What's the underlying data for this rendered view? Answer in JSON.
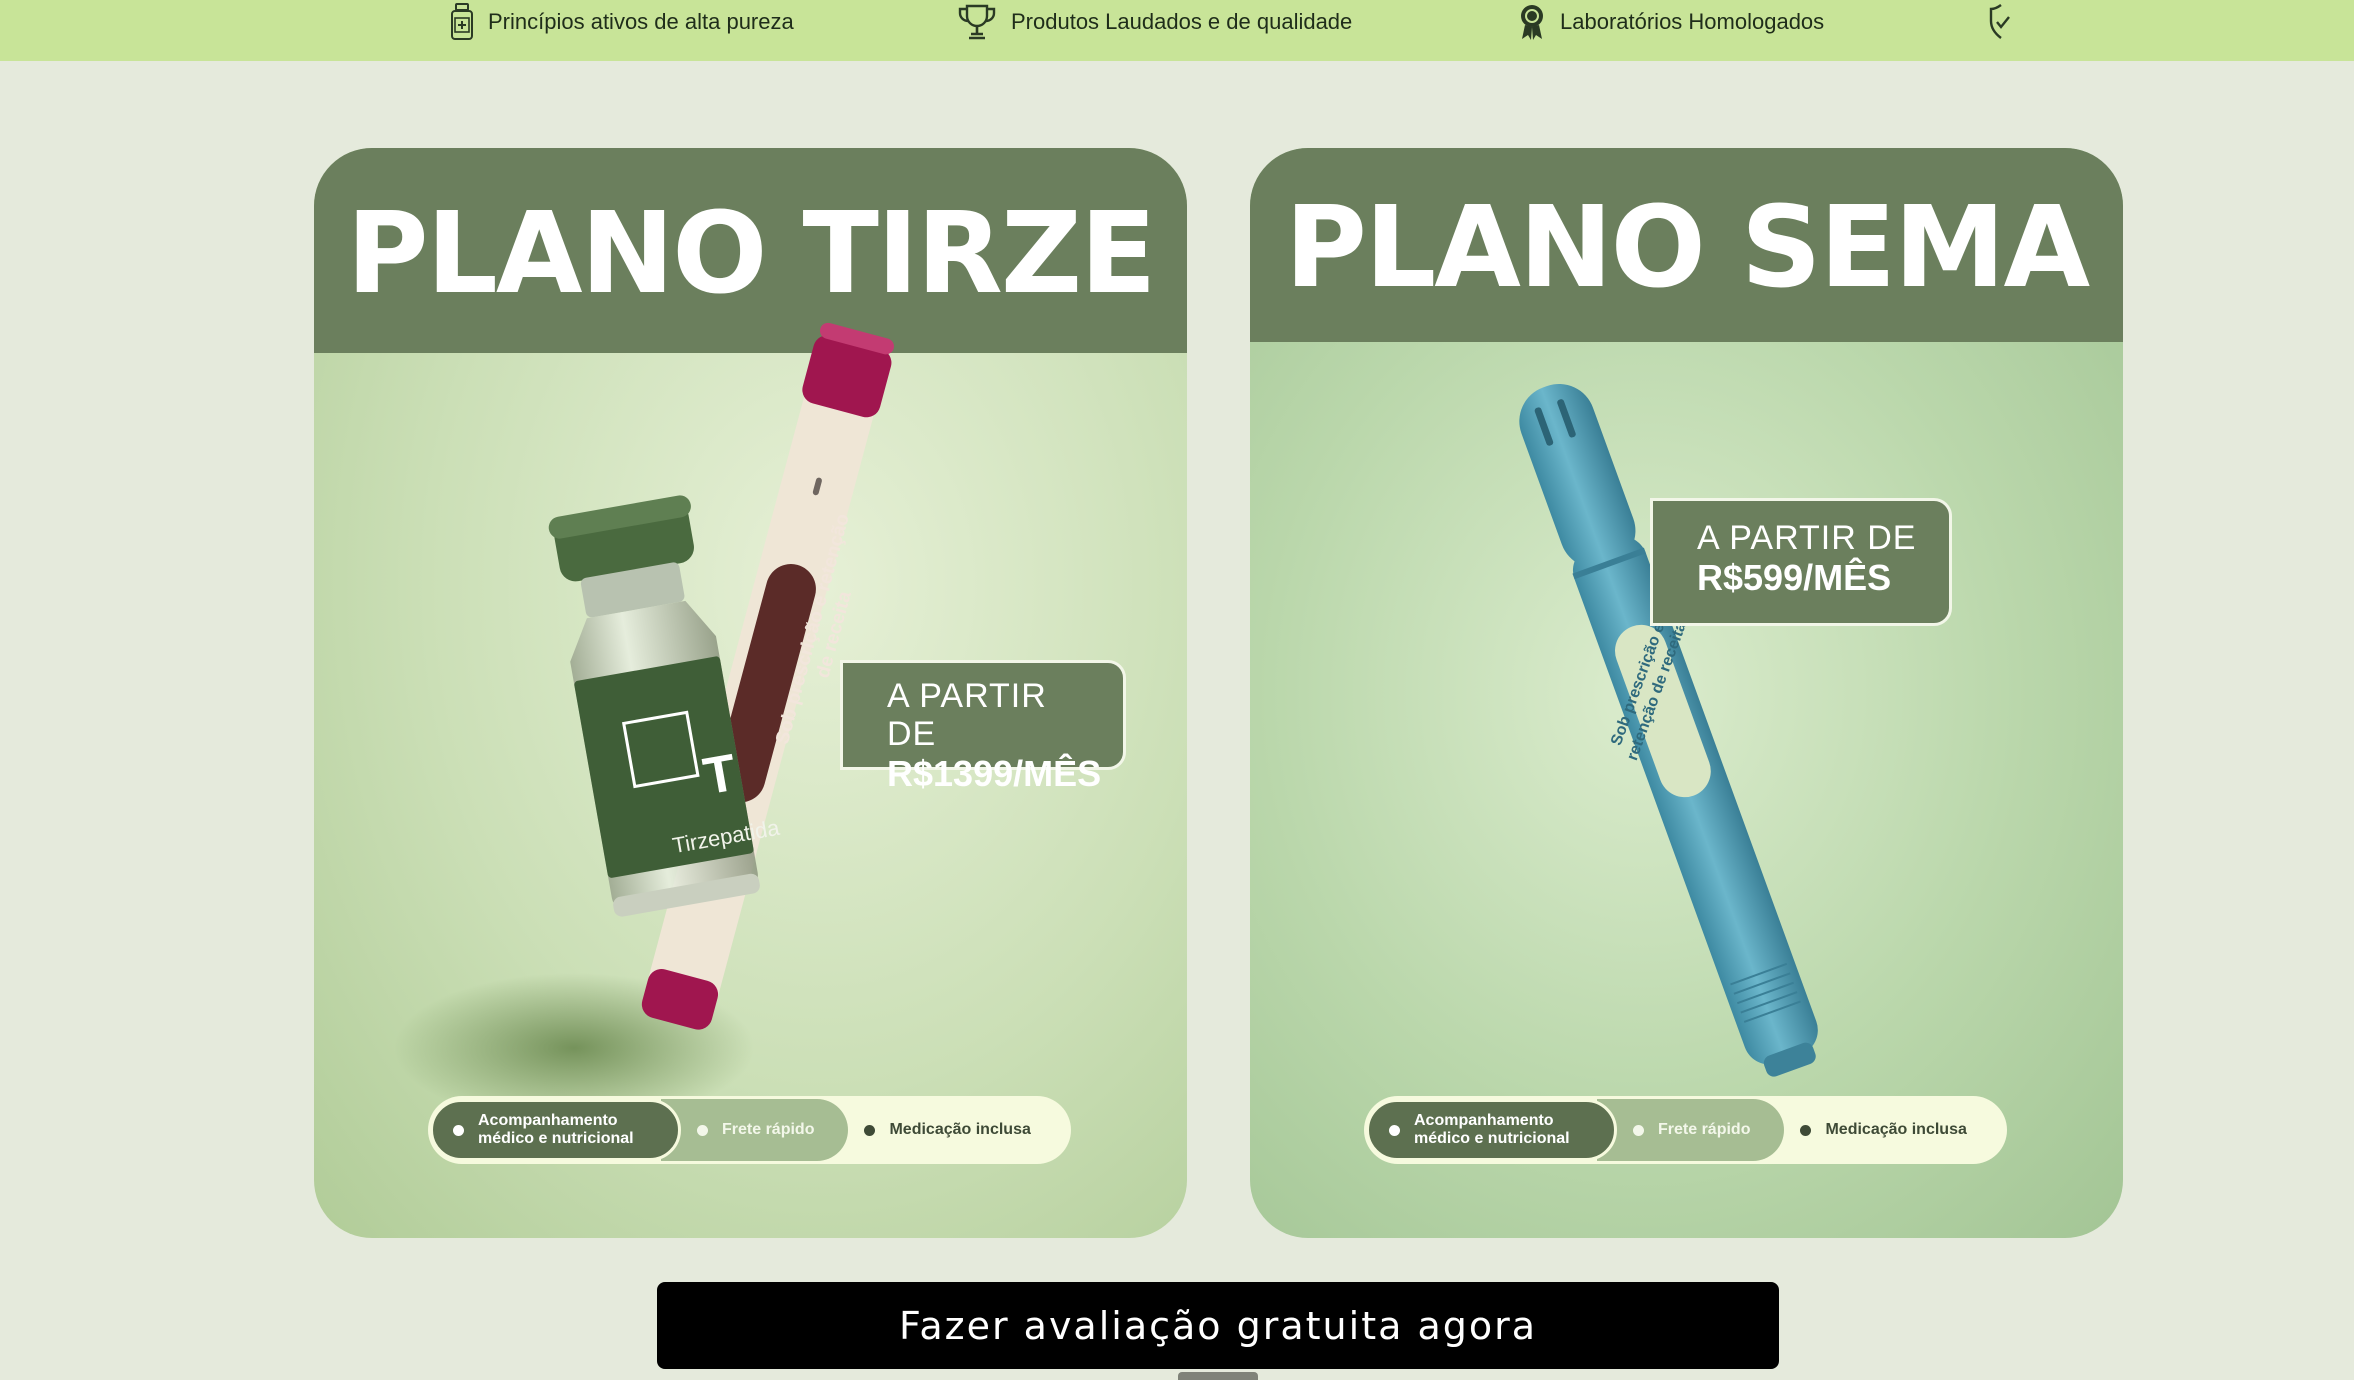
{
  "trust_bar": {
    "items": [
      {
        "icon": "medicine-bottle-icon",
        "label": "Princípios ativos de alta pureza"
      },
      {
        "icon": "trophy-icon",
        "label": "Produtos Laudados e de qualidade"
      },
      {
        "icon": "award-ribbon-icon",
        "label": "Laboratórios Homologados"
      },
      {
        "icon": "shield-check-icon",
        "label": ""
      }
    ]
  },
  "plans": [
    {
      "title": "PLANO TIRZE",
      "price_prefix": "A PARTIR DE",
      "price": "R$1399/MÊS",
      "pen_label": "Sob prescrição e retenção de receita",
      "vial_letter": "T",
      "vial_label": "Tirzepatida",
      "features": [
        "Acompanhamento médico e nutricional",
        "Frete rápido",
        "Medicação inclusa"
      ]
    },
    {
      "title": "PLANO SEMA",
      "price_prefix": "A PARTIR DE",
      "price": "R$599/MÊS",
      "pen_label": "Sob prescrição e retenção de receita",
      "features": [
        "Acompanhamento médico e nutricional",
        "Frete rápido",
        "Medicação inclusa"
      ]
    }
  ],
  "cta": {
    "label": "Fazer avaliação gratuita agora"
  },
  "colors": {
    "top_bar": "#c8e498",
    "page_bg": "#e5eadc",
    "card_header": "#6b7f5d",
    "vial_green": "#3f5e37",
    "tirze_pen_cap": "#a0164f",
    "sema_pen": "#4f9db4",
    "cta_bg": "#000000"
  }
}
